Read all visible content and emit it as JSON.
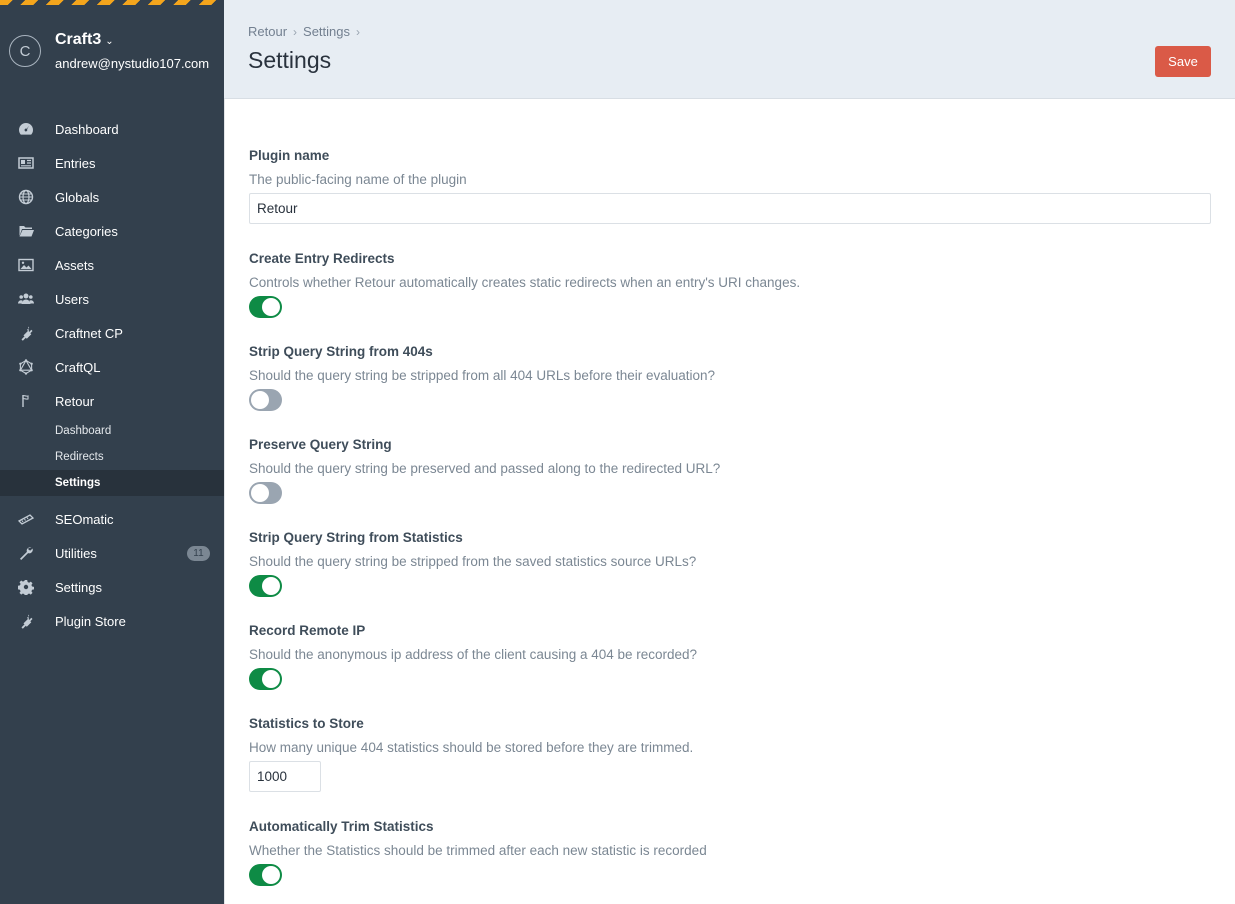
{
  "sidebar": {
    "site_initial": "C",
    "site_name": "Craft3",
    "user_email": "andrew@nystudio107.com",
    "nav": [
      {
        "label": "Dashboard",
        "icon": "dashboard-icon"
      },
      {
        "label": "Entries",
        "icon": "entries-icon"
      },
      {
        "label": "Globals",
        "icon": "globe-icon"
      },
      {
        "label": "Categories",
        "icon": "folder-icon"
      },
      {
        "label": "Assets",
        "icon": "image-icon"
      },
      {
        "label": "Users",
        "icon": "users-icon"
      },
      {
        "label": "Craftnet CP",
        "icon": "plug-icon"
      },
      {
        "label": "CraftQL",
        "icon": "graphql-icon"
      },
      {
        "label": "Retour",
        "icon": "flag-icon"
      }
    ],
    "retour_sub": [
      {
        "label": "Dashboard"
      },
      {
        "label": "Redirects"
      },
      {
        "label": "Settings"
      }
    ],
    "nav_bottom": [
      {
        "label": "SEOmatic",
        "icon": "seomatic-icon"
      },
      {
        "label": "Utilities",
        "icon": "wrench-icon",
        "badge": "11"
      },
      {
        "label": "Settings",
        "icon": "gear-icon"
      },
      {
        "label": "Plugin Store",
        "icon": "plug-icon"
      }
    ]
  },
  "header": {
    "breadcrumbs": [
      "Retour",
      "Settings"
    ],
    "title": "Settings",
    "save_label": "Save"
  },
  "fields": {
    "plugin_name": {
      "label": "Plugin name",
      "desc": "The public-facing name of the plugin",
      "value": "Retour"
    },
    "create_entry_redirects": {
      "label": "Create Entry Redirects",
      "desc": "Controls whether Retour automatically creates static redirects when an entry's URI changes.",
      "on": true
    },
    "strip_query_404": {
      "label": "Strip Query String from 404s",
      "desc": "Should the query string be stripped from all 404 URLs before their evaluation?",
      "on": false
    },
    "preserve_query": {
      "label": "Preserve Query String",
      "desc": "Should the query string be preserved and passed along to the redirected URL?",
      "on": false
    },
    "strip_query_stats": {
      "label": "Strip Query String from Statistics",
      "desc": "Should the query string be stripped from the saved statistics source URLs?",
      "on": true
    },
    "record_remote_ip": {
      "label": "Record Remote IP",
      "desc": "Should the anonymous ip address of the client causing a 404 be recorded?",
      "on": true
    },
    "statistics_to_store": {
      "label": "Statistics to Store",
      "desc": "How many unique 404 statistics should be stored before they are trimmed.",
      "value": "1000"
    },
    "auto_trim": {
      "label": "Automatically Trim Statistics",
      "desc": "Whether the Statistics should be trimmed after each new statistic is recorded",
      "on": true
    }
  },
  "colors": {
    "sidebar_bg": "#33404d",
    "header_bg": "#e7edf3",
    "save_button": "#da5a47",
    "toggle_on": "#0e8b45",
    "toggle_off": "#9aa5b1"
  }
}
